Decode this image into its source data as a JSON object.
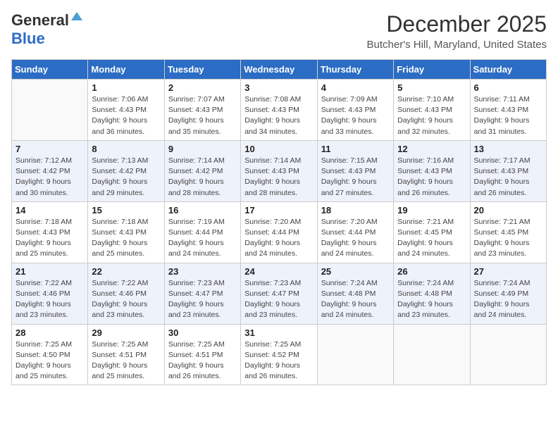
{
  "logo": {
    "line1": "General",
    "line2": "Blue"
  },
  "title": "December 2025",
  "location": "Butcher's Hill, Maryland, United States",
  "weekdays": [
    "Sunday",
    "Monday",
    "Tuesday",
    "Wednesday",
    "Thursday",
    "Friday",
    "Saturday"
  ],
  "weeks": [
    [
      {
        "day": "",
        "sunrise": "",
        "sunset": "",
        "daylight": ""
      },
      {
        "day": "1",
        "sunrise": "Sunrise: 7:06 AM",
        "sunset": "Sunset: 4:43 PM",
        "daylight": "Daylight: 9 hours and 36 minutes."
      },
      {
        "day": "2",
        "sunrise": "Sunrise: 7:07 AM",
        "sunset": "Sunset: 4:43 PM",
        "daylight": "Daylight: 9 hours and 35 minutes."
      },
      {
        "day": "3",
        "sunrise": "Sunrise: 7:08 AM",
        "sunset": "Sunset: 4:43 PM",
        "daylight": "Daylight: 9 hours and 34 minutes."
      },
      {
        "day": "4",
        "sunrise": "Sunrise: 7:09 AM",
        "sunset": "Sunset: 4:43 PM",
        "daylight": "Daylight: 9 hours and 33 minutes."
      },
      {
        "day": "5",
        "sunrise": "Sunrise: 7:10 AM",
        "sunset": "Sunset: 4:43 PM",
        "daylight": "Daylight: 9 hours and 32 minutes."
      },
      {
        "day": "6",
        "sunrise": "Sunrise: 7:11 AM",
        "sunset": "Sunset: 4:43 PM",
        "daylight": "Daylight: 9 hours and 31 minutes."
      }
    ],
    [
      {
        "day": "7",
        "sunrise": "Sunrise: 7:12 AM",
        "sunset": "Sunset: 4:42 PM",
        "daylight": "Daylight: 9 hours and 30 minutes."
      },
      {
        "day": "8",
        "sunrise": "Sunrise: 7:13 AM",
        "sunset": "Sunset: 4:42 PM",
        "daylight": "Daylight: 9 hours and 29 minutes."
      },
      {
        "day": "9",
        "sunrise": "Sunrise: 7:14 AM",
        "sunset": "Sunset: 4:42 PM",
        "daylight": "Daylight: 9 hours and 28 minutes."
      },
      {
        "day": "10",
        "sunrise": "Sunrise: 7:14 AM",
        "sunset": "Sunset: 4:43 PM",
        "daylight": "Daylight: 9 hours and 28 minutes."
      },
      {
        "day": "11",
        "sunrise": "Sunrise: 7:15 AM",
        "sunset": "Sunset: 4:43 PM",
        "daylight": "Daylight: 9 hours and 27 minutes."
      },
      {
        "day": "12",
        "sunrise": "Sunrise: 7:16 AM",
        "sunset": "Sunset: 4:43 PM",
        "daylight": "Daylight: 9 hours and 26 minutes."
      },
      {
        "day": "13",
        "sunrise": "Sunrise: 7:17 AM",
        "sunset": "Sunset: 4:43 PM",
        "daylight": "Daylight: 9 hours and 26 minutes."
      }
    ],
    [
      {
        "day": "14",
        "sunrise": "Sunrise: 7:18 AM",
        "sunset": "Sunset: 4:43 PM",
        "daylight": "Daylight: 9 hours and 25 minutes."
      },
      {
        "day": "15",
        "sunrise": "Sunrise: 7:18 AM",
        "sunset": "Sunset: 4:43 PM",
        "daylight": "Daylight: 9 hours and 25 minutes."
      },
      {
        "day": "16",
        "sunrise": "Sunrise: 7:19 AM",
        "sunset": "Sunset: 4:44 PM",
        "daylight": "Daylight: 9 hours and 24 minutes."
      },
      {
        "day": "17",
        "sunrise": "Sunrise: 7:20 AM",
        "sunset": "Sunset: 4:44 PM",
        "daylight": "Daylight: 9 hours and 24 minutes."
      },
      {
        "day": "18",
        "sunrise": "Sunrise: 7:20 AM",
        "sunset": "Sunset: 4:44 PM",
        "daylight": "Daylight: 9 hours and 24 minutes."
      },
      {
        "day": "19",
        "sunrise": "Sunrise: 7:21 AM",
        "sunset": "Sunset: 4:45 PM",
        "daylight": "Daylight: 9 hours and 24 minutes."
      },
      {
        "day": "20",
        "sunrise": "Sunrise: 7:21 AM",
        "sunset": "Sunset: 4:45 PM",
        "daylight": "Daylight: 9 hours and 23 minutes."
      }
    ],
    [
      {
        "day": "21",
        "sunrise": "Sunrise: 7:22 AM",
        "sunset": "Sunset: 4:46 PM",
        "daylight": "Daylight: 9 hours and 23 minutes."
      },
      {
        "day": "22",
        "sunrise": "Sunrise: 7:22 AM",
        "sunset": "Sunset: 4:46 PM",
        "daylight": "Daylight: 9 hours and 23 minutes."
      },
      {
        "day": "23",
        "sunrise": "Sunrise: 7:23 AM",
        "sunset": "Sunset: 4:47 PM",
        "daylight": "Daylight: 9 hours and 23 minutes."
      },
      {
        "day": "24",
        "sunrise": "Sunrise: 7:23 AM",
        "sunset": "Sunset: 4:47 PM",
        "daylight": "Daylight: 9 hours and 23 minutes."
      },
      {
        "day": "25",
        "sunrise": "Sunrise: 7:24 AM",
        "sunset": "Sunset: 4:48 PM",
        "daylight": "Daylight: 9 hours and 24 minutes."
      },
      {
        "day": "26",
        "sunrise": "Sunrise: 7:24 AM",
        "sunset": "Sunset: 4:48 PM",
        "daylight": "Daylight: 9 hours and 23 minutes."
      },
      {
        "day": "27",
        "sunrise": "Sunrise: 7:24 AM",
        "sunset": "Sunset: 4:49 PM",
        "daylight": "Daylight: 9 hours and 24 minutes."
      }
    ],
    [
      {
        "day": "28",
        "sunrise": "Sunrise: 7:25 AM",
        "sunset": "Sunset: 4:50 PM",
        "daylight": "Daylight: 9 hours and 25 minutes."
      },
      {
        "day": "29",
        "sunrise": "Sunrise: 7:25 AM",
        "sunset": "Sunset: 4:51 PM",
        "daylight": "Daylight: 9 hours and 25 minutes."
      },
      {
        "day": "30",
        "sunrise": "Sunrise: 7:25 AM",
        "sunset": "Sunset: 4:51 PM",
        "daylight": "Daylight: 9 hours and 26 minutes."
      },
      {
        "day": "31",
        "sunrise": "Sunrise: 7:25 AM",
        "sunset": "Sunset: 4:52 PM",
        "daylight": "Daylight: 9 hours and 26 minutes."
      },
      {
        "day": "",
        "sunrise": "",
        "sunset": "",
        "daylight": ""
      },
      {
        "day": "",
        "sunrise": "",
        "sunset": "",
        "daylight": ""
      },
      {
        "day": "",
        "sunrise": "",
        "sunset": "",
        "daylight": ""
      }
    ]
  ]
}
